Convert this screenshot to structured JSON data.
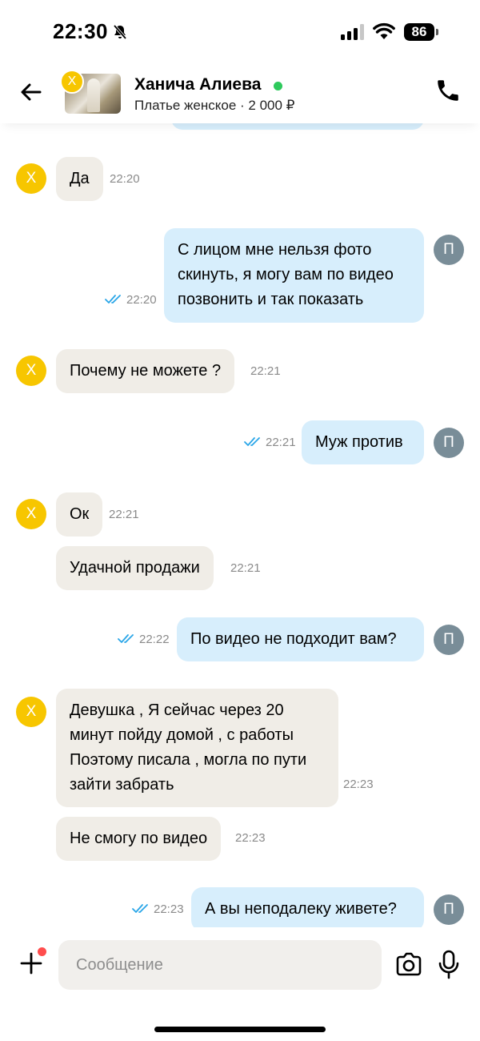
{
  "status_bar": {
    "time": "22:30",
    "battery": "86",
    "icons": [
      "bell-slash-icon",
      "cellular-signal-icon",
      "wifi-icon",
      "battery-icon"
    ]
  },
  "header": {
    "contact_name": "Ханича Алиева",
    "avatar_initial": "Х",
    "online_color": "#2ec95c",
    "listing": "Платье женское · 2 000 ₽",
    "icons": [
      "arrow-left-icon",
      "phone-icon"
    ]
  },
  "colors": {
    "incoming_bubble": "#f0ede7",
    "outgoing_bubble": "#d7eefc",
    "contact_avatar": "#f7c600",
    "my_avatar": "#798d98",
    "read_ticks": "#2aa6e8"
  },
  "messages": [
    {
      "text": "Да",
      "time": "22:20",
      "from": "them",
      "avatar": "Х"
    },
    {
      "text": "С лицом мне нельзя фото\nскинуть, я могу вам по видео\nпозвонить и так показать",
      "time": "22:20",
      "from": "me",
      "avatar": "П"
    },
    {
      "text": "Почему не можете ?",
      "time": "22:21",
      "from": "them",
      "avatar": "Х"
    },
    {
      "text": "Муж против",
      "time": "22:21",
      "from": "me",
      "avatar": "П"
    },
    {
      "text": "Ок",
      "time": "22:21",
      "from": "them",
      "avatar": "Х"
    },
    {
      "text": "Удачной продажи",
      "time": "22:21",
      "from": "them"
    },
    {
      "text": "По видео не подходит вам?",
      "time": "22:22",
      "from": "me",
      "avatar": "П"
    },
    {
      "text": "Девушка , Я сейчас через 20\nминут пойду домой , с работы\nПоэтому писала , могла по пути\nзайти забрать",
      "time": "22:23",
      "from": "them",
      "avatar": "Х"
    },
    {
      "text": "Не смогу по видео",
      "time": "22:23",
      "from": "them"
    },
    {
      "text": "А вы неподалеку живете?",
      "time": "22:23",
      "from": "me",
      "avatar": "П"
    }
  ],
  "composer": {
    "placeholder": "Сообщение",
    "icons": [
      "plus-icon",
      "camera-icon",
      "microphone-icon"
    ]
  }
}
